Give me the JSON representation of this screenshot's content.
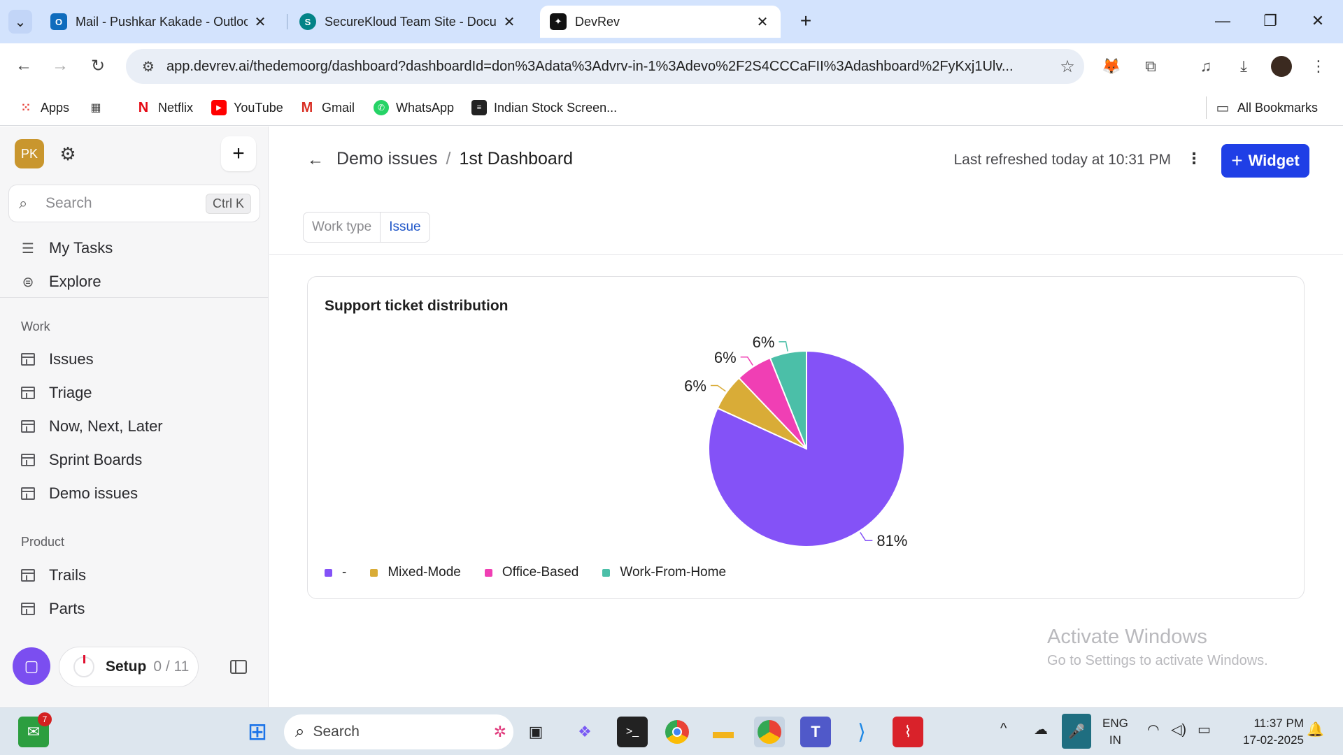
{
  "browser": {
    "tabs": [
      {
        "title": "Mail - Pushkar Kakade - Outlook",
        "icon": "outlook-icon"
      },
      {
        "title": "SecureKloud Team Site - Documents",
        "icon": "sharepoint-icon"
      },
      {
        "title": "DevRev",
        "icon": "devrev-icon"
      }
    ],
    "url": "app.devrev.ai/thedemoorg/dashboard?dashboardId=don%3Adata%3Advrv-in-1%3Adevo%2F2S4CCCaFII%3Adashboard%2FyKxj1Ulv...",
    "bookmarks": [
      "Apps",
      "Netflix",
      "YouTube",
      "Gmail",
      "WhatsApp",
      "Indian Stock Screen...",
      "All Bookmarks"
    ]
  },
  "sidebar": {
    "avatar": "PK",
    "search_placeholder": "Search",
    "search_shortcut": "Ctrl K",
    "top_items": [
      "My Tasks",
      "Explore"
    ],
    "work_label": "Work",
    "work_items": [
      "Issues",
      "Triage",
      "Now, Next, Later",
      "Sprint Boards",
      "Demo issues"
    ],
    "product_label": "Product",
    "product_items": [
      "Trails",
      "Parts"
    ],
    "setup_label": "Setup",
    "setup_count": "0 / 11"
  },
  "main": {
    "breadcrumb_parent": "Demo issues",
    "breadcrumb_sep": "/",
    "breadcrumb_current": "1st Dashboard",
    "refreshed": "Last refreshed today at 10:31 PM",
    "widget_button": "Widget",
    "filters": [
      "Work type",
      "Issue"
    ],
    "card_title": "Support ticket distribution"
  },
  "chart_data": {
    "type": "pie",
    "title": "Support ticket distribution",
    "slices": [
      {
        "label": "-",
        "value": 81,
        "display": "81%",
        "color": "#8452f7"
      },
      {
        "label": "Mixed-Mode",
        "value": 6,
        "display": "6%",
        "color": "#d9ac37"
      },
      {
        "label": "Office-Based",
        "value": 6,
        "display": "6%",
        "color": "#f03fb4"
      },
      {
        "label": "Work-From-Home",
        "value": 6,
        "display": "6%",
        "color": "#4bbfa8"
      }
    ],
    "legend_position": "bottom-left"
  },
  "watermark": {
    "line1": "Activate Windows",
    "line2": "Go to Settings to activate Windows."
  },
  "taskbar": {
    "search_placeholder": "Search",
    "lang_line1": "ENG",
    "lang_line2": "IN",
    "time": "11:37 PM",
    "date": "17-02-2025",
    "mail_badge": "7"
  }
}
